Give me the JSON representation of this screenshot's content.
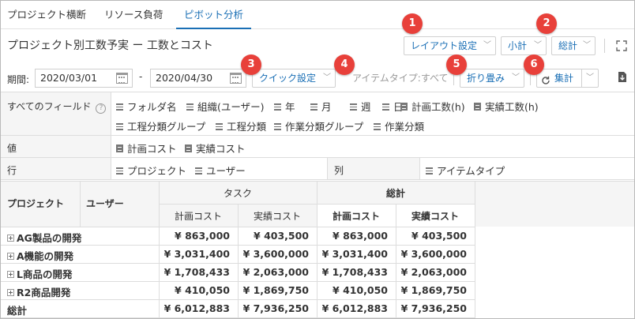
{
  "tabs": [
    {
      "label": "プロジェクト横断"
    },
    {
      "label": "リソース負荷"
    },
    {
      "label": "ピボット分析"
    }
  ],
  "header": {
    "title": "プロジェクト別工数予実 ー 工数とコスト",
    "layout_label": "レイアウト設定",
    "subtotal_label": "小計",
    "total_label": "総計"
  },
  "filter": {
    "period_label": "期間:",
    "start_date": "2020/03/01",
    "end_date": "2020/04/30",
    "dash": "-",
    "quick_label": "クイック設定",
    "item_type_label": "アイテムタイプ:すべて",
    "fold_label": "折り畳み",
    "aggregate_label": "集計"
  },
  "badges": [
    "1",
    "2",
    "3",
    "4",
    "5",
    "6"
  ],
  "fields": {
    "all_label": "すべてのフィールド",
    "all_chips_row1": [
      {
        "label": "フォルダ名",
        "icon": "hamburger-icon"
      },
      {
        "label": "組織(ユーザー)",
        "icon": "hamburger-icon"
      },
      {
        "label": "年",
        "icon": "hamburger-icon"
      },
      {
        "label": "月",
        "icon": "hamburger-icon"
      },
      {
        "label": "週",
        "icon": "hamburger-icon"
      },
      {
        "label": "日",
        "icon": "hamburger-icon"
      },
      {
        "label": "計画工数(h)",
        "icon": "document-icon"
      },
      {
        "label": "実績工数(h)",
        "icon": "document-icon"
      }
    ],
    "all_chips_row2": [
      {
        "label": "工程分類グループ",
        "icon": "hamburger-icon"
      },
      {
        "label": "工程分類",
        "icon": "hamburger-icon"
      },
      {
        "label": "作業分類グループ",
        "icon": "hamburger-icon"
      },
      {
        "label": "作業分類",
        "icon": "hamburger-icon"
      }
    ],
    "values_label": "値",
    "values_chips": [
      {
        "label": "計画コスト",
        "icon": "document-icon"
      },
      {
        "label": "実績コスト",
        "icon": "document-icon"
      }
    ],
    "rows_label": "行",
    "rows_chips": [
      {
        "label": "プロジェクト",
        "icon": "hamburger-icon"
      },
      {
        "label": "ユーザー",
        "icon": "hamburger-icon"
      }
    ],
    "cols_label": "列",
    "cols_chips": [
      {
        "label": "アイテムタイプ",
        "icon": "hamburger-icon"
      }
    ]
  },
  "table": {
    "row_header_1": "プロジェクト",
    "row_header_2": "ユーザー",
    "group_task": "タスク",
    "group_total": "総計",
    "col_plan": "計画コスト",
    "col_actual": "実績コスト",
    "rows": [
      {
        "name": "AG製品の開発",
        "values": [
          "¥ 863,000",
          "¥ 403,500",
          "¥ 863,000",
          "¥ 403,500"
        ]
      },
      {
        "name": "A機能の開発",
        "values": [
          "¥ 3,031,400",
          "¥ 3,600,000",
          "¥ 3,031,400",
          "¥ 3,600,000"
        ]
      },
      {
        "name": "L商品の開発",
        "values": [
          "¥ 1,708,433",
          "¥ 2,063,000",
          "¥ 1,708,433",
          "¥ 2,063,000"
        ]
      },
      {
        "name": "R2商品開発",
        "values": [
          "¥ 410,050",
          "¥ 1,869,750",
          "¥ 410,050",
          "¥ 1,869,750"
        ]
      }
    ],
    "total_row": {
      "name": "総計",
      "values": [
        "¥ 6,012,883",
        "¥ 7,936,250",
        "¥ 6,012,883",
        "¥ 7,936,250"
      ]
    }
  },
  "colors": {
    "accent": "#1a6fb5",
    "badge": "#e8403a"
  }
}
